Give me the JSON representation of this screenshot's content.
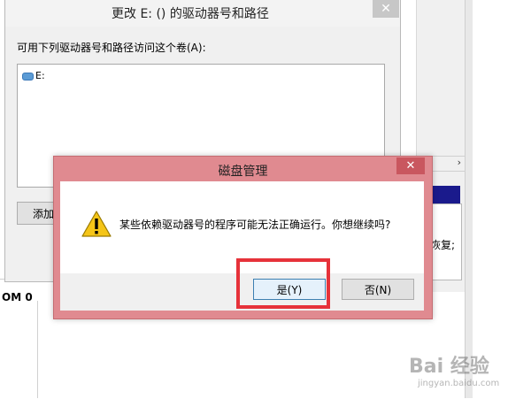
{
  "background_window": {
    "disk_label": "OM 0",
    "recover_text": "恢复;",
    "scroll_arrow": "›"
  },
  "change_dialog": {
    "title": "更改 E: () 的驱动器号和路径",
    "close_glyph": "✕",
    "list_label": "可用下列驱动器号和路径访问这个卷(A):",
    "items": [
      {
        "label": "E:",
        "icon": "drive-icon"
      }
    ],
    "add_button": "添加"
  },
  "message_dialog": {
    "title": "磁盘管理",
    "close_glyph": "✕",
    "message": "某些依赖驱动器号的程序可能无法正确运行。你想继续吗?",
    "icon": "warning-icon",
    "yes_button": "是(Y)",
    "no_button": "否(N)",
    "highlight_color": "#e6323a"
  },
  "watermark": {
    "text": "Bai 经验",
    "sub": "jingyan.baidu.com"
  }
}
